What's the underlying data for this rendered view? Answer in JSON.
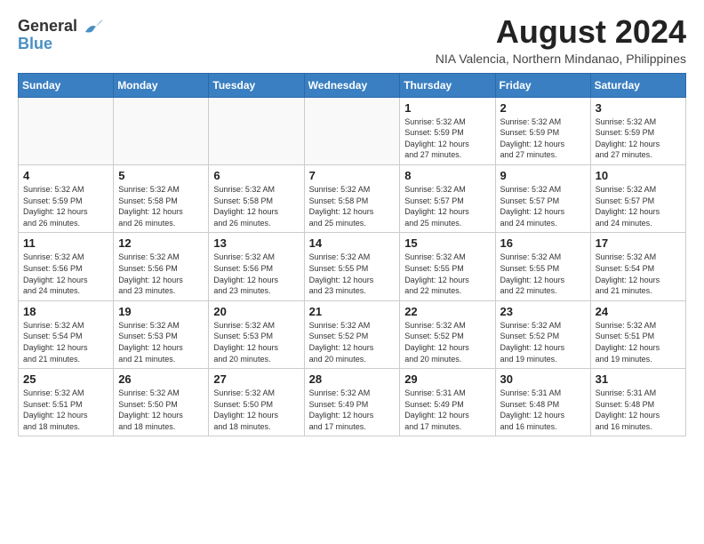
{
  "header": {
    "logo_general": "General",
    "logo_blue": "Blue",
    "month_year": "August 2024",
    "location": "NIA Valencia, Northern Mindanao, Philippines"
  },
  "weekdays": [
    "Sunday",
    "Monday",
    "Tuesday",
    "Wednesday",
    "Thursday",
    "Friday",
    "Saturday"
  ],
  "weeks": [
    [
      {
        "day": "",
        "info": ""
      },
      {
        "day": "",
        "info": ""
      },
      {
        "day": "",
        "info": ""
      },
      {
        "day": "",
        "info": ""
      },
      {
        "day": "1",
        "info": "Sunrise: 5:32 AM\nSunset: 5:59 PM\nDaylight: 12 hours\nand 27 minutes."
      },
      {
        "day": "2",
        "info": "Sunrise: 5:32 AM\nSunset: 5:59 PM\nDaylight: 12 hours\nand 27 minutes."
      },
      {
        "day": "3",
        "info": "Sunrise: 5:32 AM\nSunset: 5:59 PM\nDaylight: 12 hours\nand 27 minutes."
      }
    ],
    [
      {
        "day": "4",
        "info": "Sunrise: 5:32 AM\nSunset: 5:59 PM\nDaylight: 12 hours\nand 26 minutes."
      },
      {
        "day": "5",
        "info": "Sunrise: 5:32 AM\nSunset: 5:58 PM\nDaylight: 12 hours\nand 26 minutes."
      },
      {
        "day": "6",
        "info": "Sunrise: 5:32 AM\nSunset: 5:58 PM\nDaylight: 12 hours\nand 26 minutes."
      },
      {
        "day": "7",
        "info": "Sunrise: 5:32 AM\nSunset: 5:58 PM\nDaylight: 12 hours\nand 25 minutes."
      },
      {
        "day": "8",
        "info": "Sunrise: 5:32 AM\nSunset: 5:57 PM\nDaylight: 12 hours\nand 25 minutes."
      },
      {
        "day": "9",
        "info": "Sunrise: 5:32 AM\nSunset: 5:57 PM\nDaylight: 12 hours\nand 24 minutes."
      },
      {
        "day": "10",
        "info": "Sunrise: 5:32 AM\nSunset: 5:57 PM\nDaylight: 12 hours\nand 24 minutes."
      }
    ],
    [
      {
        "day": "11",
        "info": "Sunrise: 5:32 AM\nSunset: 5:56 PM\nDaylight: 12 hours\nand 24 minutes."
      },
      {
        "day": "12",
        "info": "Sunrise: 5:32 AM\nSunset: 5:56 PM\nDaylight: 12 hours\nand 23 minutes."
      },
      {
        "day": "13",
        "info": "Sunrise: 5:32 AM\nSunset: 5:56 PM\nDaylight: 12 hours\nand 23 minutes."
      },
      {
        "day": "14",
        "info": "Sunrise: 5:32 AM\nSunset: 5:55 PM\nDaylight: 12 hours\nand 23 minutes."
      },
      {
        "day": "15",
        "info": "Sunrise: 5:32 AM\nSunset: 5:55 PM\nDaylight: 12 hours\nand 22 minutes."
      },
      {
        "day": "16",
        "info": "Sunrise: 5:32 AM\nSunset: 5:55 PM\nDaylight: 12 hours\nand 22 minutes."
      },
      {
        "day": "17",
        "info": "Sunrise: 5:32 AM\nSunset: 5:54 PM\nDaylight: 12 hours\nand 21 minutes."
      }
    ],
    [
      {
        "day": "18",
        "info": "Sunrise: 5:32 AM\nSunset: 5:54 PM\nDaylight: 12 hours\nand 21 minutes."
      },
      {
        "day": "19",
        "info": "Sunrise: 5:32 AM\nSunset: 5:53 PM\nDaylight: 12 hours\nand 21 minutes."
      },
      {
        "day": "20",
        "info": "Sunrise: 5:32 AM\nSunset: 5:53 PM\nDaylight: 12 hours\nand 20 minutes."
      },
      {
        "day": "21",
        "info": "Sunrise: 5:32 AM\nSunset: 5:52 PM\nDaylight: 12 hours\nand 20 minutes."
      },
      {
        "day": "22",
        "info": "Sunrise: 5:32 AM\nSunset: 5:52 PM\nDaylight: 12 hours\nand 20 minutes."
      },
      {
        "day": "23",
        "info": "Sunrise: 5:32 AM\nSunset: 5:52 PM\nDaylight: 12 hours\nand 19 minutes."
      },
      {
        "day": "24",
        "info": "Sunrise: 5:32 AM\nSunset: 5:51 PM\nDaylight: 12 hours\nand 19 minutes."
      }
    ],
    [
      {
        "day": "25",
        "info": "Sunrise: 5:32 AM\nSunset: 5:51 PM\nDaylight: 12 hours\nand 18 minutes."
      },
      {
        "day": "26",
        "info": "Sunrise: 5:32 AM\nSunset: 5:50 PM\nDaylight: 12 hours\nand 18 minutes."
      },
      {
        "day": "27",
        "info": "Sunrise: 5:32 AM\nSunset: 5:50 PM\nDaylight: 12 hours\nand 18 minutes."
      },
      {
        "day": "28",
        "info": "Sunrise: 5:32 AM\nSunset: 5:49 PM\nDaylight: 12 hours\nand 17 minutes."
      },
      {
        "day": "29",
        "info": "Sunrise: 5:31 AM\nSunset: 5:49 PM\nDaylight: 12 hours\nand 17 minutes."
      },
      {
        "day": "30",
        "info": "Sunrise: 5:31 AM\nSunset: 5:48 PM\nDaylight: 12 hours\nand 16 minutes."
      },
      {
        "day": "31",
        "info": "Sunrise: 5:31 AM\nSunset: 5:48 PM\nDaylight: 12 hours\nand 16 minutes."
      }
    ]
  ]
}
